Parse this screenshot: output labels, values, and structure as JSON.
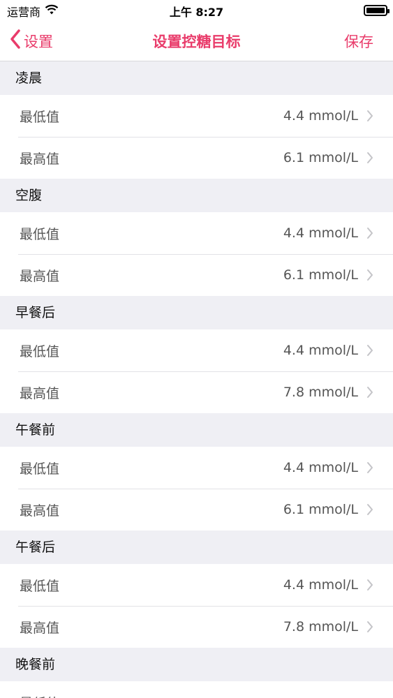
{
  "status": {
    "carrier": "运营商",
    "time": "上午 8:27"
  },
  "nav": {
    "back_label": "设置",
    "title": "设置控糖目标",
    "save_label": "保存"
  },
  "sections": [
    {
      "title": "凌晨",
      "rows": [
        {
          "label": "最低值",
          "value": "4.4 mmol/L"
        },
        {
          "label": "最高值",
          "value": "6.1 mmol/L"
        }
      ]
    },
    {
      "title": "空腹",
      "rows": [
        {
          "label": "最低值",
          "value": "4.4 mmol/L"
        },
        {
          "label": "最高值",
          "value": "6.1 mmol/L"
        }
      ]
    },
    {
      "title": "早餐后",
      "rows": [
        {
          "label": "最低值",
          "value": "4.4 mmol/L"
        },
        {
          "label": "最高值",
          "value": "7.8 mmol/L"
        }
      ]
    },
    {
      "title": "午餐前",
      "rows": [
        {
          "label": "最低值",
          "value": "4.4 mmol/L"
        },
        {
          "label": "最高值",
          "value": "6.1 mmol/L"
        }
      ]
    },
    {
      "title": "午餐后",
      "rows": [
        {
          "label": "最低值",
          "value": "4.4 mmol/L"
        },
        {
          "label": "最高值",
          "value": "7.8 mmol/L"
        }
      ]
    },
    {
      "title": "晚餐前",
      "rows": [
        {
          "label": "最低值"
        }
      ]
    }
  ],
  "colors": {
    "accent": "#e93c6b",
    "background": "#efeff4"
  }
}
